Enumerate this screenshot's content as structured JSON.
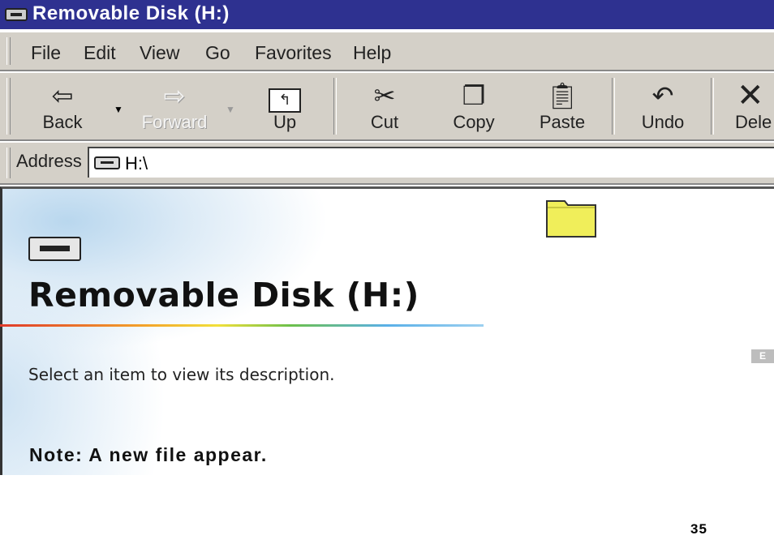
{
  "window": {
    "title": "Removable Disk (H:)",
    "title_icon": "drive-icon"
  },
  "menu": [
    "File",
    "Edit",
    "View",
    "Go",
    "Favorites",
    "Help"
  ],
  "toolbar": {
    "back": {
      "label": "Back",
      "icon": "back-arrow-icon"
    },
    "forward": {
      "label": "Forward",
      "icon": "forward-arrow-icon",
      "disabled": true
    },
    "up": {
      "label": "Up",
      "icon": "up-folder-icon"
    },
    "cut": {
      "label": "Cut",
      "icon": "scissors-icon"
    },
    "copy": {
      "label": "Copy",
      "icon": "copy-icon"
    },
    "paste": {
      "label": "Paste",
      "icon": "paste-icon"
    },
    "undo": {
      "label": "Undo",
      "icon": "undo-icon"
    },
    "delete": {
      "label": "Dele",
      "icon": "delete-x-icon"
    }
  },
  "address": {
    "label": "Address",
    "value": "H:\\"
  },
  "content": {
    "heading": "Removable Disk (H:)",
    "description": "Select an item to view its description."
  },
  "note": "Note: A new file appear.",
  "language_tab": "E",
  "page_number": "35",
  "colors": {
    "titlebar": "#2e3190",
    "chrome": "#d4d0c8",
    "folder": "#f0ee5a"
  }
}
